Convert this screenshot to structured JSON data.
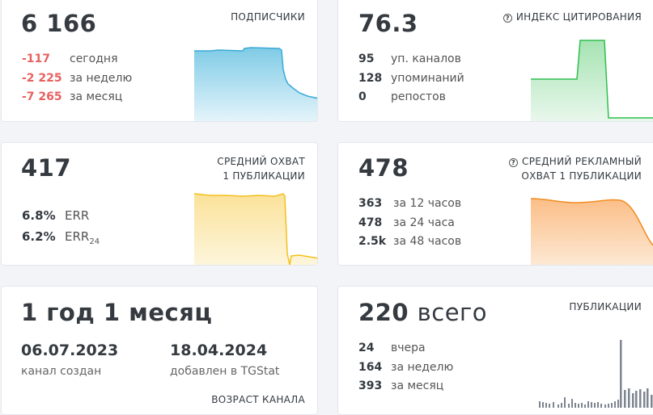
{
  "subscribers": {
    "value": "6 166",
    "title": "ПОДПИСЧИКИ",
    "rows": [
      {
        "value": "-117",
        "label": "сегодня"
      },
      {
        "value": "-2 225",
        "label": "за неделю"
      },
      {
        "value": "-7 265",
        "label": "за месяц"
      }
    ],
    "color": "#5ab8de"
  },
  "citation": {
    "value": "76.3",
    "title": "ИНДЕКС ЦИТИРОВАНИЯ",
    "icon": "question-circle-icon",
    "rows": [
      {
        "value": "95",
        "label": "уп. каналов"
      },
      {
        "value": "128",
        "label": "упоминаний"
      },
      {
        "value": "0",
        "label": "репостов"
      }
    ],
    "color": "#2fbf4f"
  },
  "reach": {
    "value": "417",
    "title_line1": "СРЕДНИЙ ОХВАТ",
    "title_line2": "1 ПУБЛИКАЦИИ",
    "err_value": "6.8%",
    "err_label": "ERR",
    "err24_value": "6.2%",
    "err24_label": "ERR",
    "err24_sub": "24",
    "color": "#f5c526"
  },
  "ad_reach": {
    "value": "478",
    "title_line1": "СРЕДНИЙ РЕКЛАМНЫЙ",
    "title_line2": "ОХВАТ 1 ПУБЛИКАЦИИ",
    "icon": "question-circle-icon",
    "rows": [
      {
        "value": "363",
        "label": "за 12 часов"
      },
      {
        "value": "478",
        "label": "за 24 часа"
      },
      {
        "value": "2.5k",
        "label": "за 48 часов"
      }
    ],
    "color": "#f28c1e"
  },
  "age": {
    "value": "1 год 1 месяц",
    "created_date": "06.07.2023",
    "created_label": "канал создан",
    "added_date": "18.04.2024",
    "added_label": "добавлен в TGStat",
    "title": "ВОЗРАСТ КАНАЛА"
  },
  "posts": {
    "value": "220",
    "value_suffix": "всего",
    "title": "ПУБЛИКАЦИИ",
    "rows": [
      {
        "value": "24",
        "label": "вчера"
      },
      {
        "value": "164",
        "label": "за неделю"
      },
      {
        "value": "393",
        "label": "за месяц"
      }
    ],
    "color": "#7d8590"
  }
}
